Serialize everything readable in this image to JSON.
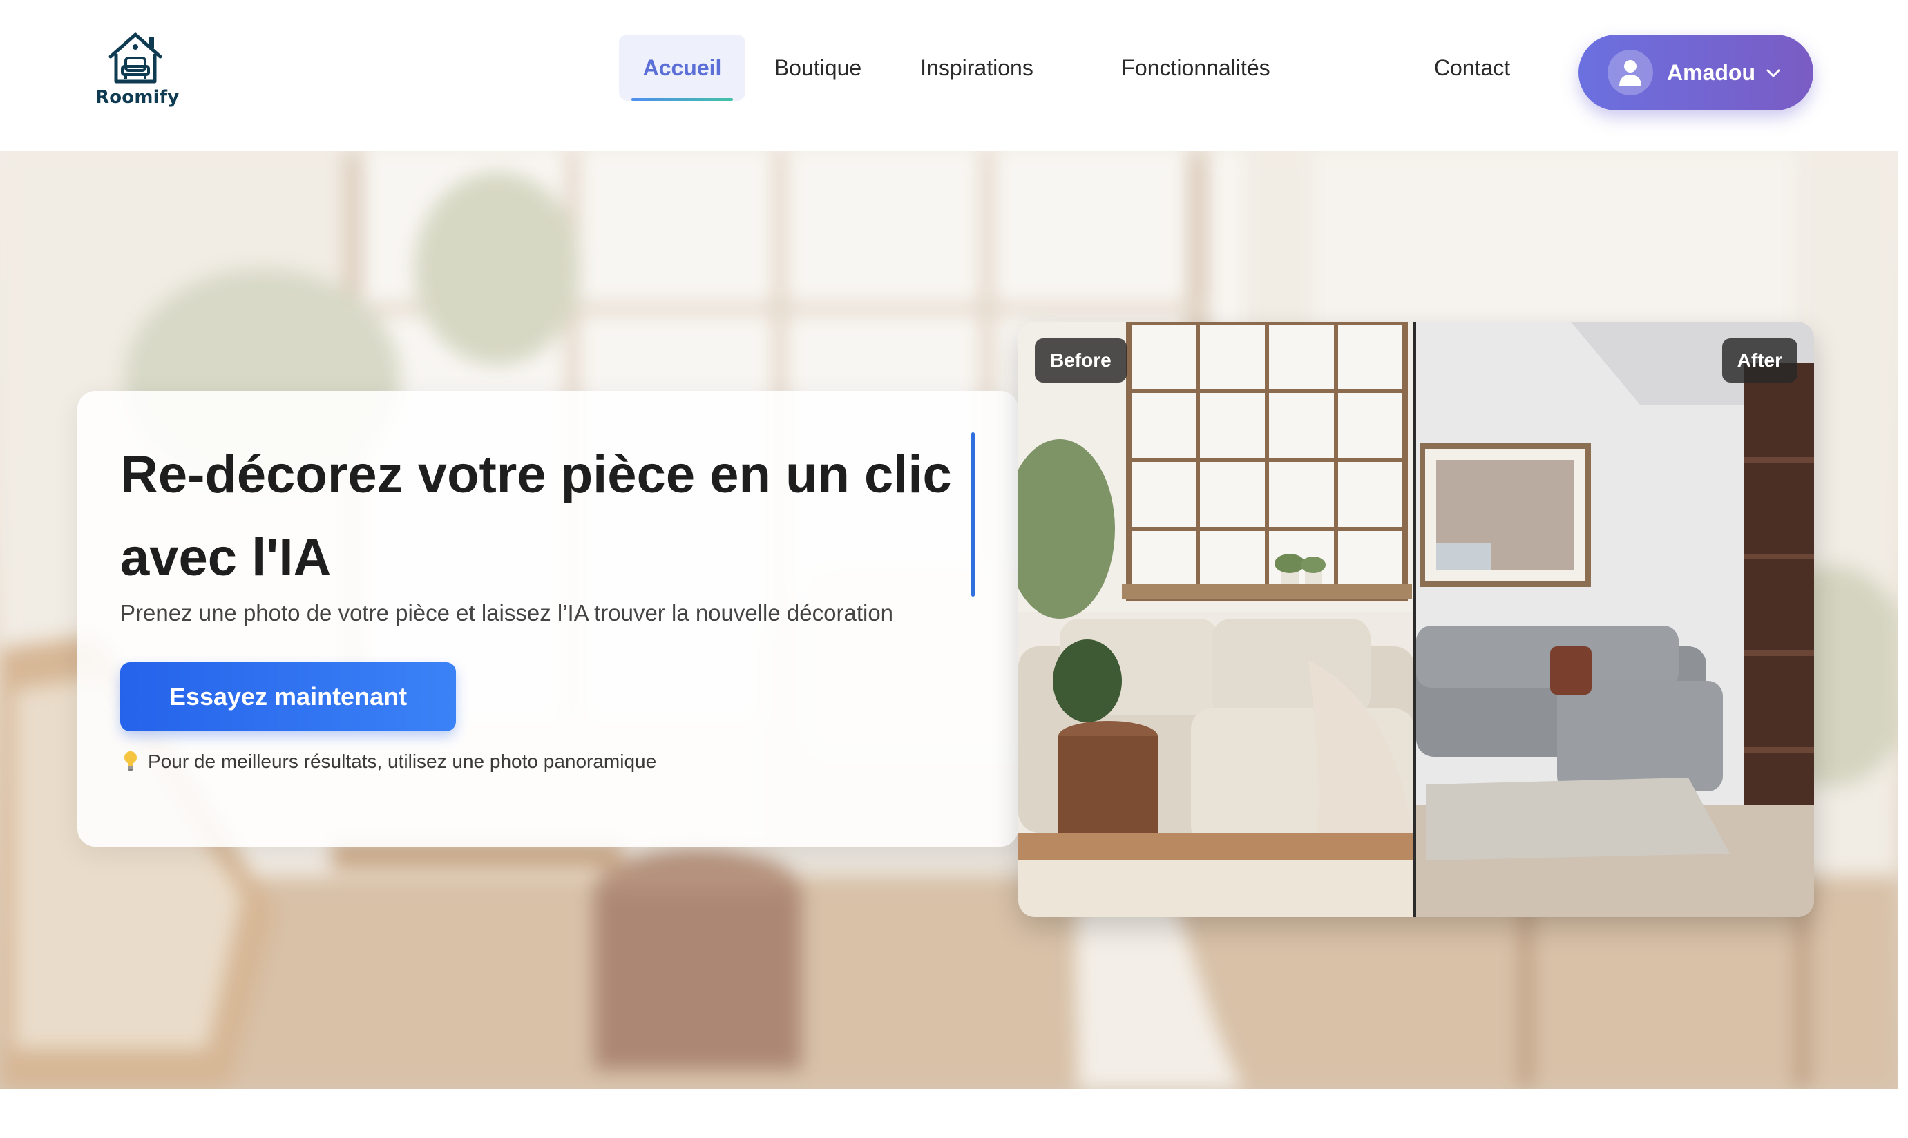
{
  "brand": {
    "name": "Roomify"
  },
  "nav": {
    "items": [
      {
        "label": "Accueil",
        "active": true
      },
      {
        "label": "Boutique",
        "active": false
      },
      {
        "label": "Inspirations",
        "active": false
      },
      {
        "label": "Fonctionnalités",
        "active": false
      },
      {
        "label": "Contact",
        "active": false
      }
    ]
  },
  "user": {
    "name": "Amadou",
    "icon": "user-icon",
    "menu_icon": "chevron-down-icon"
  },
  "hero": {
    "title": "Re-décorez votre pièce en un clic avec l'IA",
    "subtitle": "Prenez une photo de votre pièce et laissez l’IA trouver la nouvelle décoration",
    "cta_label": "Essayez maintenant",
    "tip_icon": "lightbulb-icon",
    "tip": "Pour de meilleurs résultats, utilisez une photo panoramique"
  },
  "comparison": {
    "before_label": "Before",
    "after_label": "After"
  },
  "colors": {
    "accent": "#2563eb",
    "nav_active": "#5b6fd6",
    "user_gradient_start": "#6b70e0",
    "user_gradient_end": "#7a5cc4",
    "logo": "#0f3b52"
  }
}
